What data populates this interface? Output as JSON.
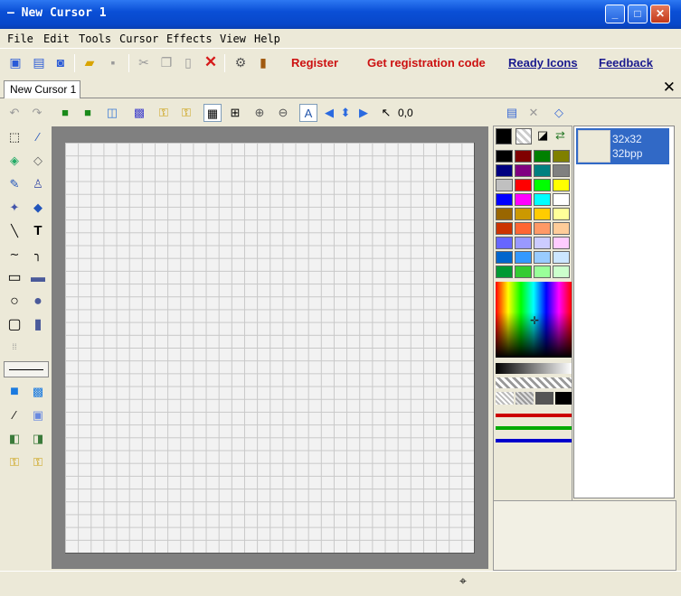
{
  "window": {
    "title": "— New Cursor 1",
    "controls": [
      "_",
      "□",
      "✕"
    ]
  },
  "menu": [
    "File",
    "Edit",
    "Tools",
    "Cursor",
    "Effects",
    "View",
    "Help"
  ],
  "toolbar": {
    "register": "Register",
    "get_code": "Get registration code",
    "ready_icons": "Ready Icons",
    "feedback": "Feedback"
  },
  "tab": {
    "label": "New Cursor 1",
    "close": "✕"
  },
  "coordinates": "0,0",
  "image_list": {
    "size": "32x32",
    "depth": "32bpp"
  },
  "colors": {
    "title_bar": "#0a4fd6",
    "register_text": "#cc1111",
    "link_text": "#1a1a8e",
    "selection": "#3169c6"
  },
  "palette_colors": [
    [
      "#000000",
      "#800000",
      "#008000",
      "#808000"
    ],
    [
      "#000080",
      "#800080",
      "#008080",
      "#808080"
    ],
    [
      "#c0c0c0",
      "#ff0000",
      "#00ff00",
      "#ffff00"
    ],
    [
      "#0000ff",
      "#ff00ff",
      "#00ffff",
      "#ffffff"
    ],
    [
      "#996600",
      "#cc9900",
      "#ffcc00",
      "#ffff99"
    ],
    [
      "#cc3300",
      "#ff6633",
      "#ff9966",
      "#ffcc99"
    ],
    [
      "#6666ff",
      "#9999ff",
      "#ccccff",
      "#ffccff"
    ],
    [
      "#0066cc",
      "#3399ff",
      "#99ccff",
      "#cce6ff"
    ],
    [
      "#009933",
      "#33cc33",
      "#99ff99",
      "#ccffcc"
    ]
  ]
}
